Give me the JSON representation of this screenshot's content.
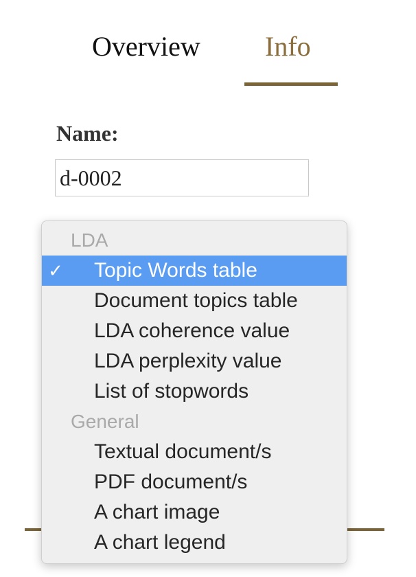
{
  "tabs": [
    {
      "label": "Overview",
      "active": false
    },
    {
      "label": "Info",
      "active": true
    }
  ],
  "form": {
    "name_label": "Name:",
    "name_value": "d-0002"
  },
  "dropdown": {
    "groups": [
      {
        "label": "LDA",
        "options": [
          "Topic Words table",
          "Document topics table",
          "LDA coherence value",
          "LDA perplexity value",
          "List of stopwords"
        ]
      },
      {
        "label": "General",
        "options": [
          "Textual document/s",
          "PDF document/s",
          "A chart image",
          "A chart legend"
        ]
      }
    ],
    "selected": "Topic Words table"
  },
  "colors": {
    "accent": "#7b6436",
    "active_tab_text": "#8a6d3b",
    "selection_highlight": "#5a9cf2",
    "group_label": "#a9a9a9"
  },
  "icons": {
    "check": "✓"
  }
}
